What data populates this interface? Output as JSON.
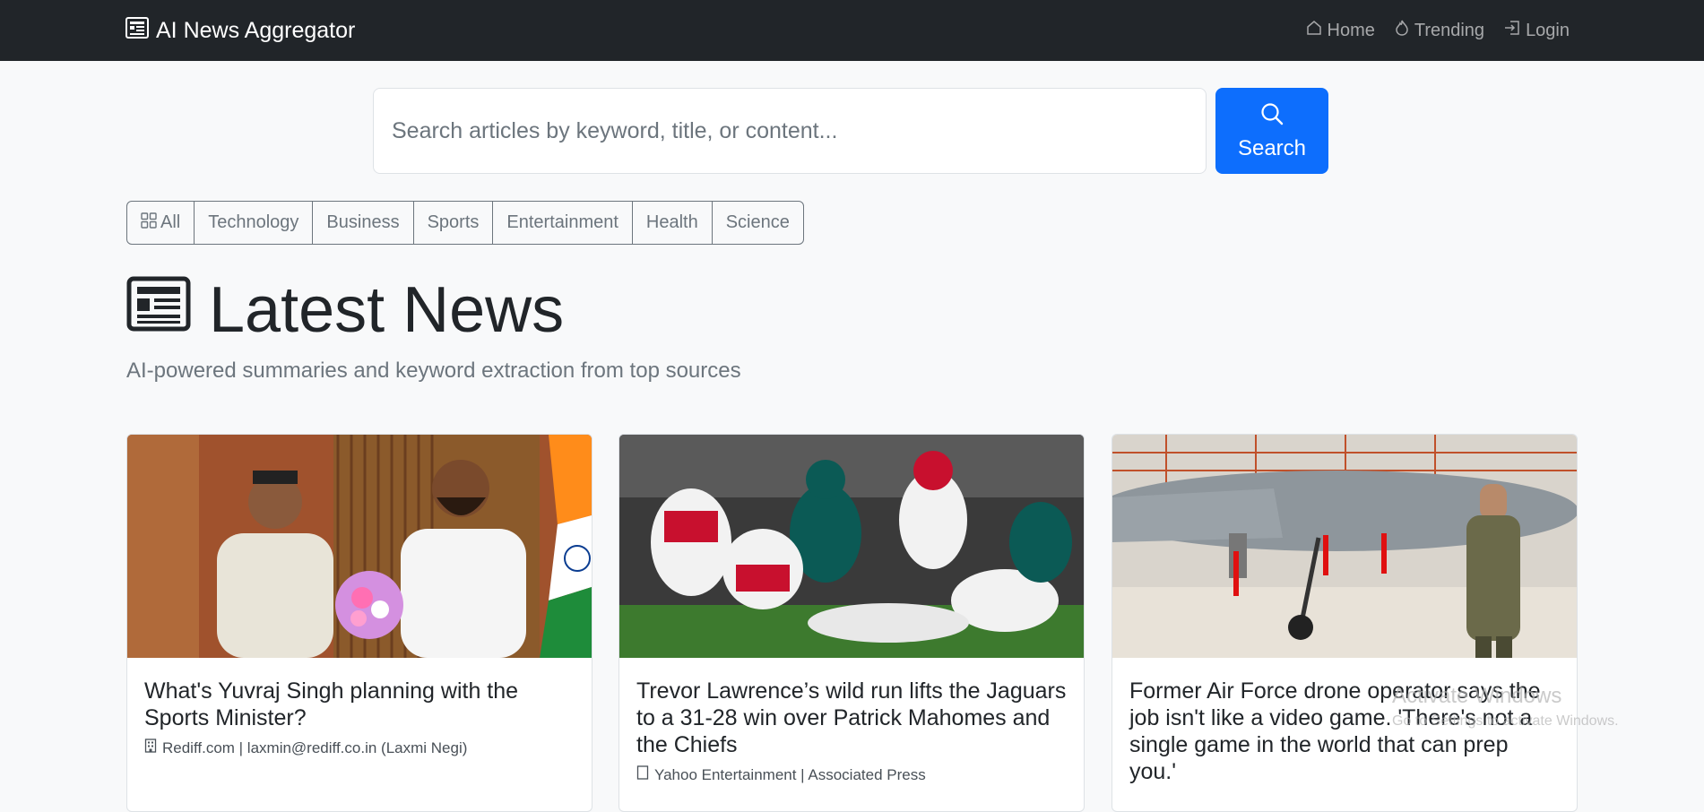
{
  "navbar": {
    "brand": "AI News Aggregator",
    "links": [
      {
        "label": "Home",
        "icon": "house-icon"
      },
      {
        "label": "Trending",
        "icon": "fire-icon"
      },
      {
        "label": "Login",
        "icon": "login-icon"
      }
    ]
  },
  "search": {
    "placeholder": "Search articles by keyword, title, or content...",
    "button_label": "Search"
  },
  "categories": [
    "All",
    "Technology",
    "Business",
    "Sports",
    "Entertainment",
    "Health",
    "Science"
  ],
  "main": {
    "title": "Latest News",
    "subtitle": "AI-powered summaries and keyword extraction from top sources"
  },
  "articles": [
    {
      "title": "What's Yuvraj Singh planning with the Sports Minister?",
      "meta": "Rediff.com | laxmin@rediff.co.in (Laxmi Negi)"
    },
    {
      "title": "Trevor Lawrence’s wild run lifts the Jaguars to a 31-28 win over Patrick Mahomes and the Chiefs",
      "meta": "Yahoo Entertainment | Associated Press"
    },
    {
      "title": "Former Air Force drone operator says the job isn't like a video game. 'There's not a single game in the world that can prep you.'",
      "meta": ""
    }
  ],
  "watermark": {
    "line1": "Activate Windows",
    "line2": "Go to Settings to activate Windows."
  },
  "colors": {
    "navbar_bg": "#212529",
    "primary": "#0d6efd",
    "page_bg": "#f8f9fa"
  }
}
